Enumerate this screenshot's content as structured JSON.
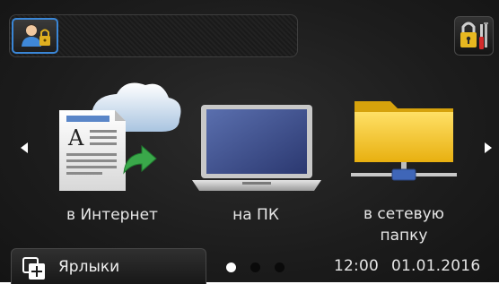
{
  "header": {
    "user_icon": "user-lock-icon",
    "admin_icon": "padlock-tools-icon"
  },
  "navigation": {
    "prev_icon": "arrow-left-icon",
    "next_icon": "arrow-right-icon"
  },
  "tiles": [
    {
      "label": "в Интернет",
      "icon": "document-cloud-upload-icon"
    },
    {
      "label": "на ПК",
      "icon": "laptop-icon"
    },
    {
      "label_line1": "в сетевую",
      "label_line2": "папку",
      "icon": "network-folder-icon"
    }
  ],
  "footer": {
    "shortcuts_label": "Ярлыки",
    "shortcuts_icon": "shortcuts-add-icon",
    "page_indicator": {
      "pages": 3,
      "active": 1
    },
    "time": "12:00",
    "date": "01.01.2016"
  },
  "colors": {
    "accent": "#3a86d6",
    "folder": "#f2c21a",
    "cloud_arrow": "#3aa84a",
    "dot_active": "#ffffff",
    "dot_inactive": "#1e1e1e"
  }
}
